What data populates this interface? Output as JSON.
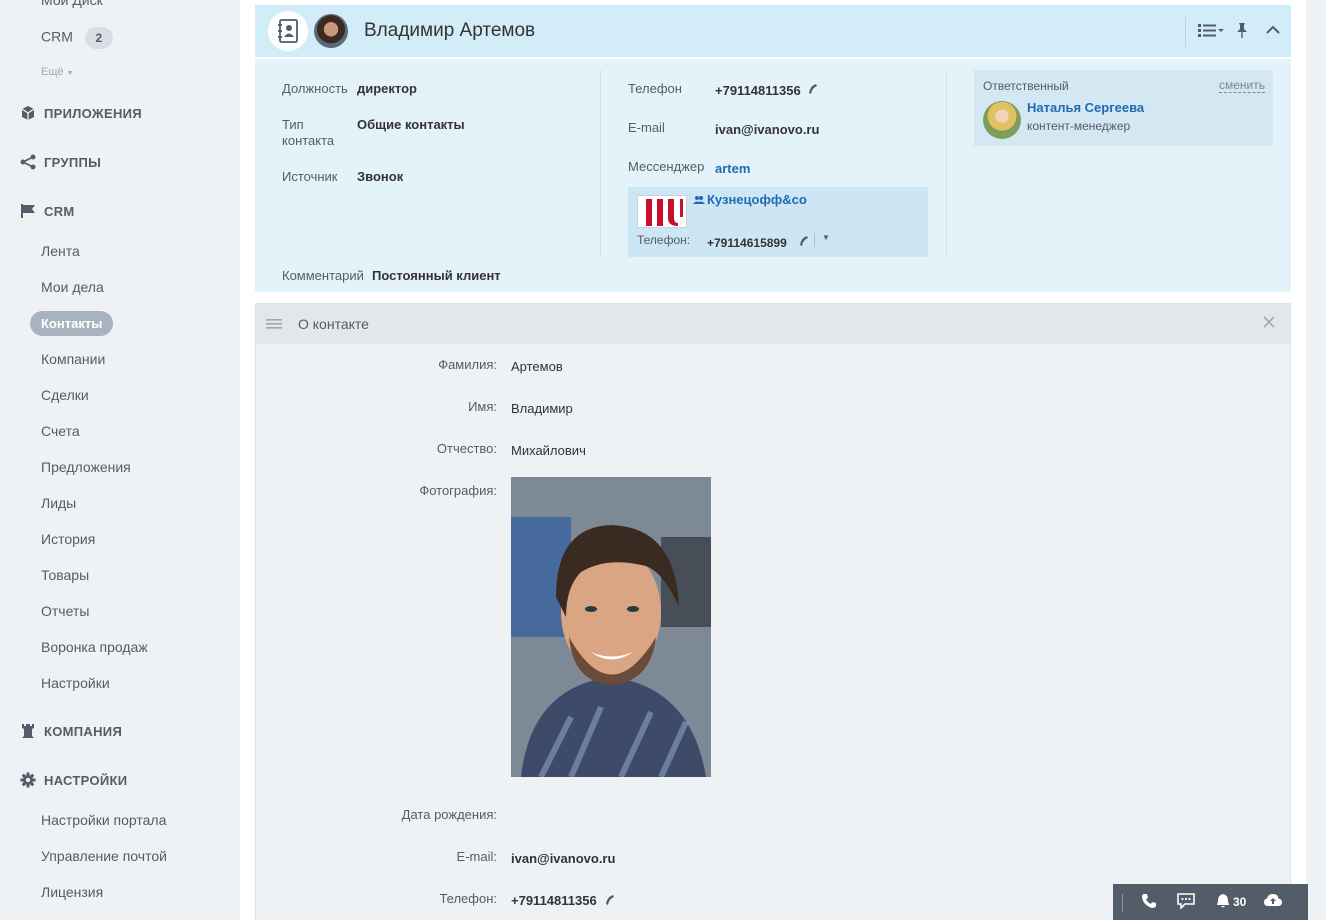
{
  "sidebar": {
    "disk": "Мой Диск",
    "crm_top": "CRM",
    "crm_badge": "2",
    "more": "Ещё",
    "sections": {
      "apps": "ПРИЛОЖЕНИЯ",
      "groups": "ГРУППЫ",
      "crm": "CRM",
      "company": "КОМПАНИЯ",
      "settings": "НАСТРОЙКИ"
    },
    "crm_items": [
      "Лента",
      "Мои дела",
      "Контакты",
      "Компании",
      "Сделки",
      "Счета",
      "Предложения",
      "Лиды",
      "История",
      "Товары",
      "Отчеты",
      "Воронка продаж",
      "Настройки"
    ],
    "settings_items": [
      "Настройки портала",
      "Управление почтой",
      "Лицензия"
    ]
  },
  "header": {
    "name": "Владимир Артемов"
  },
  "info": {
    "position_label": "Должность",
    "position_value": "директор",
    "type_label_1": "Тип",
    "type_label_2": "контакта",
    "type_value": "Общие контакты",
    "source_label": "Источник",
    "source_value": "Звонок",
    "phone_label": "Телефон",
    "phone_value": "+79114811356",
    "email_label": "E-mail",
    "email_value": "ivan@ivanovo.ru",
    "messenger_label": "Мессенджер",
    "messenger_value": "artem",
    "company_name": "Кузнецофф&со",
    "company_phone_label": "Телефон:",
    "company_phone_value": "+79114615899",
    "comment_label": "Комментарий",
    "comment_value": "Постоянный клиент",
    "responsible_label": "Ответственный",
    "change_link": "сменить",
    "responsible_name": "Наталья Сергеева",
    "responsible_role": "контент-менеджер"
  },
  "about": {
    "title": "О контакте",
    "fields": [
      {
        "label": "Фамилия:",
        "value": "Артемов"
      },
      {
        "label": "Имя:",
        "value": "Владимир"
      },
      {
        "label": "Отчество:",
        "value": "Михайлович"
      },
      {
        "label": "Фотография:",
        "value": ""
      },
      {
        "label": "Дата рождения:",
        "value": ""
      },
      {
        "label": "E-mail:",
        "value": "ivan@ivanovo.ru"
      },
      {
        "label": "Телефон:",
        "value": "+79114811356"
      }
    ]
  },
  "bottom_bar": {
    "notifications_count": "30"
  }
}
